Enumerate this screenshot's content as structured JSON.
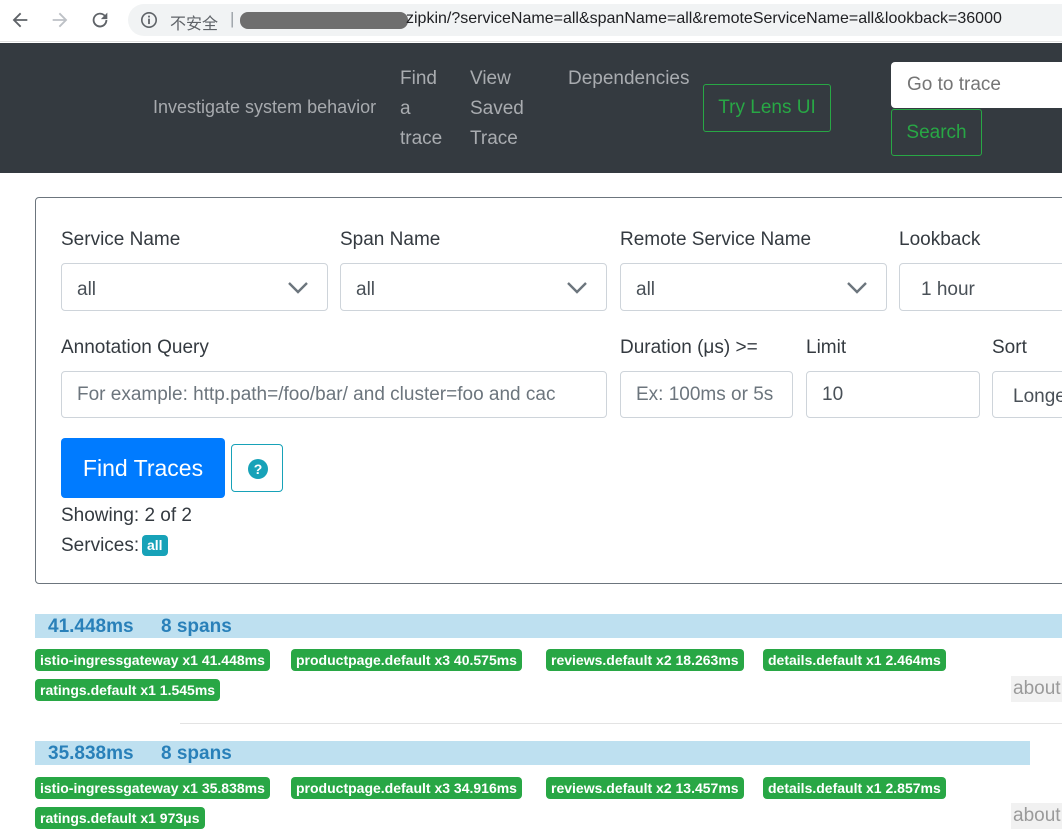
{
  "browser": {
    "security_label": "不安全",
    "separator": "|",
    "url_visible": "zipkin/?serviceName=all&spanName=all&remoteServiceName=all&lookback=36000"
  },
  "header": {
    "tagline": "Investigate system behavior",
    "nav": {
      "find_trace": [
        "Find",
        "a",
        "trace"
      ],
      "view_saved": [
        "View",
        "Saved",
        "Trace"
      ],
      "dependencies": "Dependencies"
    },
    "lens_button": "Try Lens UI",
    "goto_placeholder": "Go to trace",
    "search_button": "Search"
  },
  "form": {
    "service_name": {
      "label": "Service Name",
      "value": "all"
    },
    "span_name": {
      "label": "Span Name",
      "value": "all"
    },
    "remote_service": {
      "label": "Remote Service Name",
      "value": "all"
    },
    "lookback": {
      "label": "Lookback",
      "value": "1 hour"
    },
    "annotation": {
      "label": "Annotation Query",
      "placeholder": "For example: http.path=/foo/bar/ and cluster=foo and cac"
    },
    "duration": {
      "label": "Duration (μs) >=",
      "placeholder": "Ex: 100ms or 5s"
    },
    "limit": {
      "label": "Limit",
      "value": "10"
    },
    "sort": {
      "label": "Sort",
      "value": "Longe"
    },
    "find_button": "Find Traces",
    "help_icon": "question-circle-icon"
  },
  "summary": {
    "showing": "Showing: 2 of 2",
    "services_label": "Services:",
    "services_badge": "all"
  },
  "traces": [
    {
      "duration": "41.448ms",
      "spans": "8 spans",
      "services": [
        "istio-ingressgateway x1 41.448ms",
        "productpage.default x3 40.575ms",
        "reviews.default x2 18.263ms",
        "details.default x1 2.464ms",
        "ratings.default x1 1.545ms"
      ],
      "about": "about"
    },
    {
      "duration": "35.838ms",
      "spans": "8 spans",
      "services": [
        "istio-ingressgateway x1 35.838ms",
        "productpage.default x3 34.916ms",
        "reviews.default x2 13.457ms",
        "details.default x1 2.857ms",
        "ratings.default x1 973μs"
      ],
      "about": "about"
    }
  ],
  "colors": {
    "header_bg": "#343a40",
    "accent_green": "#28a745",
    "primary_blue": "#007bff",
    "info_teal": "#17a2b8",
    "trace_bar": "#bee0f0"
  }
}
